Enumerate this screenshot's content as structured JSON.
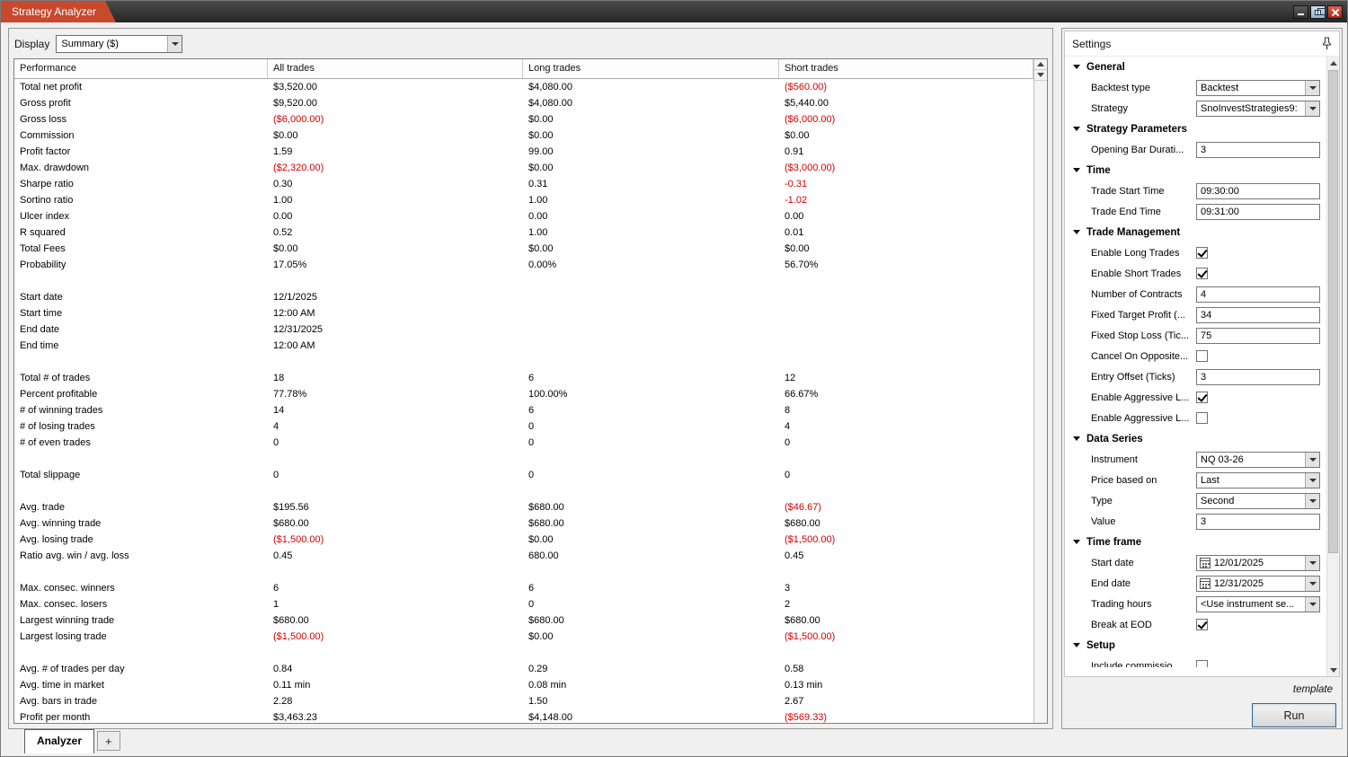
{
  "window": {
    "title": "Strategy Analyzer"
  },
  "toolbar": {
    "display_label": "Display",
    "display_value": "Summary ($)"
  },
  "table": {
    "columns": [
      "Performance",
      "All trades",
      "Long trades",
      "Short trades"
    ],
    "rows": [
      {
        "label": "Total net profit",
        "all": "$3,520.00",
        "long": "$4,080.00",
        "short": "($560.00)"
      },
      {
        "label": "Gross profit",
        "all": "$9,520.00",
        "long": "$4,080.00",
        "short": "$5,440.00"
      },
      {
        "label": "Gross loss",
        "all": "($6,000.00)",
        "long": "$0.00",
        "short": "($6,000.00)"
      },
      {
        "label": "Commission",
        "all": "$0.00",
        "long": "$0.00",
        "short": "$0.00"
      },
      {
        "label": "Profit factor",
        "all": "1.59",
        "long": "99.00",
        "short": "0.91"
      },
      {
        "label": "Max. drawdown",
        "all": "($2,320.00)",
        "long": "$0.00",
        "short": "($3,000.00)"
      },
      {
        "label": "Sharpe ratio",
        "all": "0.30",
        "long": "0.31",
        "short": "-0.31"
      },
      {
        "label": "Sortino ratio",
        "all": "1.00",
        "long": "1.00",
        "short": "-1.02"
      },
      {
        "label": "Ulcer index",
        "all": "0.00",
        "long": "0.00",
        "short": "0.00"
      },
      {
        "label": "R squared",
        "all": "0.52",
        "long": "1.00",
        "short": "0.01"
      },
      {
        "label": "Total Fees",
        "all": "$0.00",
        "long": "$0.00",
        "short": "$0.00"
      },
      {
        "label": "Probability",
        "all": "17.05%",
        "long": "0.00%",
        "short": "56.70%"
      },
      {
        "label": "",
        "all": "",
        "long": "",
        "short": ""
      },
      {
        "label": "Start date",
        "all": "12/1/2025",
        "long": "",
        "short": ""
      },
      {
        "label": "Start time",
        "all": "12:00 AM",
        "long": "",
        "short": ""
      },
      {
        "label": "End date",
        "all": "12/31/2025",
        "long": "",
        "short": ""
      },
      {
        "label": "End time",
        "all": "12:00 AM",
        "long": "",
        "short": ""
      },
      {
        "label": "",
        "all": "",
        "long": "",
        "short": ""
      },
      {
        "label": "Total # of trades",
        "all": "18",
        "long": "6",
        "short": "12"
      },
      {
        "label": "Percent profitable",
        "all": "77.78%",
        "long": "100.00%",
        "short": "66.67%"
      },
      {
        "label": "# of winning trades",
        "all": "14",
        "long": "6",
        "short": "8"
      },
      {
        "label": "# of losing trades",
        "all": "4",
        "long": "0",
        "short": "4"
      },
      {
        "label": "# of even trades",
        "all": "0",
        "long": "0",
        "short": "0"
      },
      {
        "label": "",
        "all": "",
        "long": "",
        "short": ""
      },
      {
        "label": "Total slippage",
        "all": "0",
        "long": "0",
        "short": "0"
      },
      {
        "label": "",
        "all": "",
        "long": "",
        "short": ""
      },
      {
        "label": "Avg. trade",
        "all": "$195.56",
        "long": "$680.00",
        "short": "($46.67)"
      },
      {
        "label": "Avg. winning trade",
        "all": "$680.00",
        "long": "$680.00",
        "short": "$680.00"
      },
      {
        "label": "Avg. losing trade",
        "all": "($1,500.00)",
        "long": "$0.00",
        "short": "($1,500.00)"
      },
      {
        "label": "Ratio avg. win / avg. loss",
        "all": "0.45",
        "long": "680.00",
        "short": "0.45"
      },
      {
        "label": "",
        "all": "",
        "long": "",
        "short": ""
      },
      {
        "label": "Max. consec. winners",
        "all": "6",
        "long": "6",
        "short": "3"
      },
      {
        "label": "Max. consec. losers",
        "all": "1",
        "long": "0",
        "short": "2"
      },
      {
        "label": "Largest winning trade",
        "all": "$680.00",
        "long": "$680.00",
        "short": "$680.00"
      },
      {
        "label": "Largest losing trade",
        "all": "($1,500.00)",
        "long": "$0.00",
        "short": "($1,500.00)"
      },
      {
        "label": "",
        "all": "",
        "long": "",
        "short": ""
      },
      {
        "label": "Avg. # of trades per day",
        "all": "0.84",
        "long": "0.29",
        "short": "0.58"
      },
      {
        "label": "Avg. time in market",
        "all": "0.11 min",
        "long": "0.08 min",
        "short": "0.13 min"
      },
      {
        "label": "Avg. bars in trade",
        "all": "2.28",
        "long": "1.50",
        "short": "2.67"
      },
      {
        "label": "Profit per month",
        "all": "$3,463.23",
        "long": "$4,148.00",
        "short": "($569.33)"
      }
    ]
  },
  "settings": {
    "title": "Settings",
    "sections": [
      {
        "label": "General",
        "fields": [
          {
            "label": "Backtest type",
            "type": "select",
            "value": "Backtest"
          },
          {
            "label": "Strategy",
            "type": "select",
            "value": "SnoInvestStrategies9:"
          }
        ]
      },
      {
        "label": "Strategy Parameters",
        "fields": [
          {
            "label": "Opening Bar Durati...",
            "type": "input",
            "value": "3"
          }
        ]
      },
      {
        "label": "Time",
        "fields": [
          {
            "label": "Trade Start Time",
            "type": "input",
            "value": "09:30:00"
          },
          {
            "label": "Trade End Time",
            "type": "input",
            "value": "09:31:00"
          }
        ]
      },
      {
        "label": "Trade Management",
        "fields": [
          {
            "label": "Enable Long Trades",
            "type": "checkbox",
            "checked": true
          },
          {
            "label": "Enable Short Trades",
            "type": "checkbox",
            "checked": true
          },
          {
            "label": "Number of Contracts",
            "type": "input",
            "value": "4"
          },
          {
            "label": "Fixed Target Profit (...",
            "type": "input",
            "value": "34"
          },
          {
            "label": "Fixed Stop Loss (Tic...",
            "type": "input",
            "value": "75"
          },
          {
            "label": "Cancel On Opposite...",
            "type": "checkbox",
            "checked": false
          },
          {
            "label": "Entry Offset (Ticks)",
            "type": "input",
            "value": "3"
          },
          {
            "label": "Enable Aggressive L...",
            "type": "checkbox",
            "checked": true
          },
          {
            "label": "Enable Aggressive L...",
            "type": "checkbox",
            "checked": false
          }
        ]
      },
      {
        "label": "Data Series",
        "fields": [
          {
            "label": "Instrument",
            "type": "select",
            "value": "NQ 03-26"
          },
          {
            "label": "Price based on",
            "type": "select",
            "value": "Last"
          },
          {
            "label": "Type",
            "type": "select",
            "value": "Second"
          },
          {
            "label": "Value",
            "type": "input",
            "value": "3"
          }
        ]
      },
      {
        "label": "Time frame",
        "fields": [
          {
            "label": "Start date",
            "type": "date",
            "value": "12/01/2025"
          },
          {
            "label": "End date",
            "type": "date",
            "value": "12/31/2025"
          },
          {
            "label": "Trading hours",
            "type": "select",
            "value": "<Use instrument se..."
          },
          {
            "label": "Break at EOD",
            "type": "checkbox",
            "checked": true
          }
        ]
      },
      {
        "label": "Setup",
        "fields": [
          {
            "label": "Include commissio...",
            "type": "checkbox",
            "checked": false
          }
        ]
      }
    ],
    "template_label": "template",
    "run_label": "Run"
  },
  "tabs": {
    "analyzer": "Analyzer",
    "add": "+"
  }
}
